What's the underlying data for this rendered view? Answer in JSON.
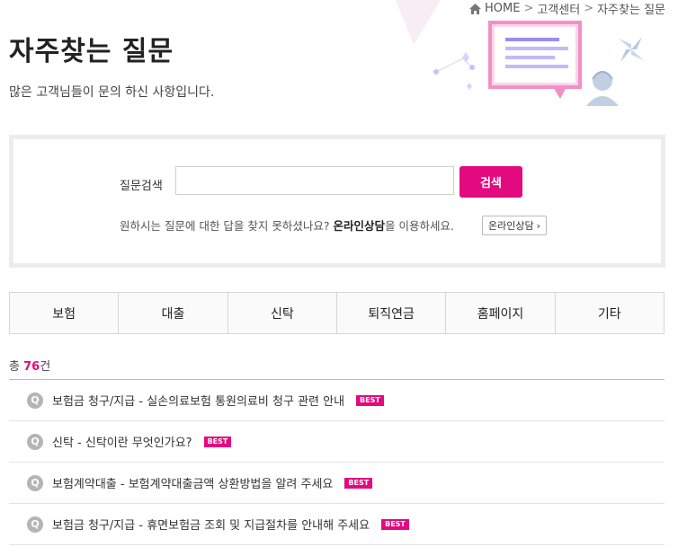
{
  "breadcrumb": {
    "home": "HOME",
    "level1": "고객센터",
    "level2": "자주찾는 질문",
    "separator": ">"
  },
  "page": {
    "title": "자주찾는 질문",
    "subtitle": "많은 고객님들이 문의 하신 사항입니다."
  },
  "search": {
    "label": "질문검색",
    "value": "",
    "placeholder": "",
    "button": "검색",
    "help_prefix": "원하시는 질문에 대한 답을 찾지 못하셨나요? ",
    "help_link": "온라인상담",
    "help_suffix": "을 이용하세요.",
    "online_button": "온라인상담",
    "online_arrow": "›"
  },
  "tabs": [
    "보험",
    "대출",
    "신탁",
    "퇴직연금",
    "홈페이지",
    "기타"
  ],
  "total": {
    "prefix": "총 ",
    "count": "76",
    "suffix": "건"
  },
  "faq": {
    "q_icon": "Q",
    "badge": "BEST",
    "items": [
      {
        "text": "보험금 청구/지급 - 실손의료보험 통원의료비 청구 관련 안내",
        "best": true
      },
      {
        "text": "신탁 - 신탁이란 무엇인가요?",
        "best": true
      },
      {
        "text": "보험계약대출 - 보험계약대출금액 상환방법을 알려 주세요",
        "best": true
      },
      {
        "text": "보험금 청구/지급 - 휴면보험금 조회 및 지급절차를 안내해 주세요",
        "best": true
      }
    ]
  },
  "colors": {
    "accent": "#e3097f",
    "illustration_purple": "#9b8cf0",
    "illustration_pink": "#f7a3cf"
  }
}
